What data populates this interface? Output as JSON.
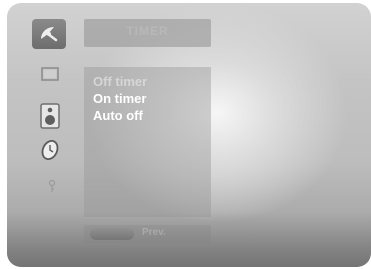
{
  "sidebar": {
    "icons": [
      {
        "name": "station",
        "icon": "satellite-dish-icon"
      },
      {
        "name": "picture",
        "icon": "screen-icon"
      },
      {
        "name": "sound",
        "icon": "speaker-icon"
      },
      {
        "name": "time",
        "icon": "clock-icon"
      },
      {
        "name": "special",
        "icon": "key-icon"
      }
    ]
  },
  "header": {
    "title": "TIMER"
  },
  "menu": {
    "items": [
      {
        "label": "Off timer",
        "state": "dim"
      },
      {
        "label": "On timer",
        "state": "normal"
      },
      {
        "label": "Auto off",
        "state": "selected"
      }
    ]
  },
  "footer": {
    "prev_label": "Prev."
  },
  "colors": {
    "menu_text": "#ffffff",
    "panel_bg": "#c4c4c4"
  }
}
